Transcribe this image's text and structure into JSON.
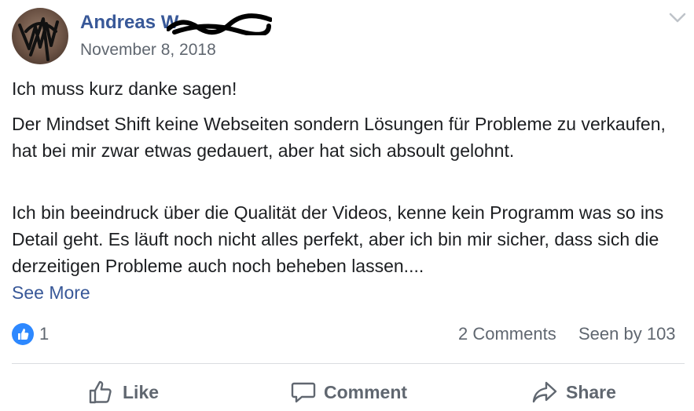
{
  "post": {
    "author": "Andreas W",
    "date": "November 8, 2018",
    "paragraphs": [
      "Ich muss kurz danke sagen!",
      "Der Mindset Shift keine Webseiten sondern Lösungen für Probleme zu verkaufen, hat bei mir zwar etwas gedauert, aber hat sich absoult gelohnt.",
      "Ich bin beeindruck über die Qualität der Videos, kenne kein Programm was so ins Detail geht. Es läuft noch nicht alles perfekt, aber ich bin mir sicher, dass sich die derzeitigen Probleme auch noch beheben lassen...."
    ],
    "see_more": "See More"
  },
  "stats": {
    "like_count": "1",
    "comments": "2 Comments",
    "seen_by": "Seen by 103"
  },
  "actions": {
    "like": "Like",
    "comment": "Comment",
    "share": "Share"
  },
  "icons": {
    "options": "chevron-down-icon",
    "like_badge": "thumbs-up-icon",
    "like": "thumbs-up-outline-icon",
    "comment": "speech-bubble-icon",
    "share": "share-arrow-icon"
  },
  "colors": {
    "link": "#385898",
    "secondary_text": "#606770",
    "like_blue": "#2d88ff",
    "divider": "#dadde1"
  }
}
